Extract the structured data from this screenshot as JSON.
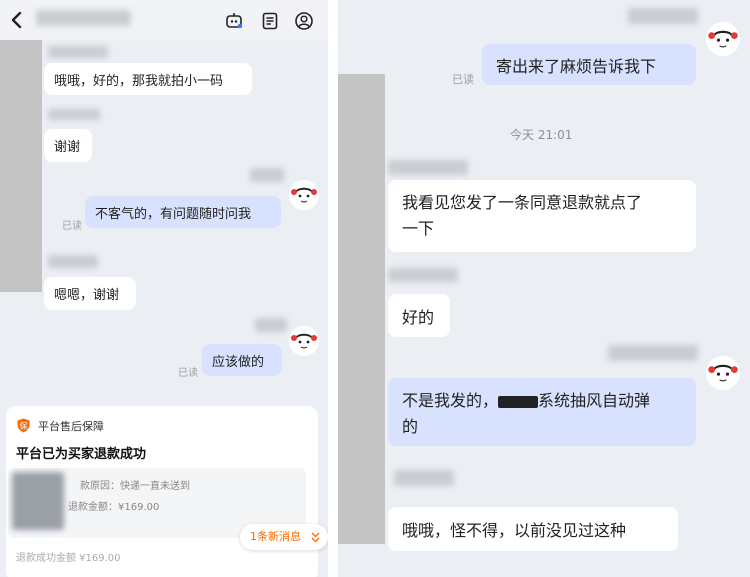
{
  "left": {
    "messages": {
      "m1": "哦哦，好的，那我就拍小一码",
      "m2": "谢谢",
      "m3": "不客气的，有问题随时问我",
      "m4": "嗯嗯，谢谢",
      "m5": "应该做的"
    },
    "read_label": "已读",
    "card": {
      "header": "平台售后保障",
      "badge": "保",
      "title": "平台已为买家退款成功",
      "reason": "款原因：快递一直未送到",
      "amount": "退款金额：¥169.00",
      "footer": "退款成功金额 ¥169.00"
    },
    "new_messages": "1条新消息",
    "colors": {
      "accent": "#ff6a00",
      "mine_bubble": "#d8e2ff"
    }
  },
  "right": {
    "messages": {
      "r1": "寄出来了麻烦告诉我下",
      "r2a": "我看见您发了一条同意退款就点了",
      "r2b": "一下",
      "r3": "好的",
      "r4a": "不是我发的，",
      "r4b": "系统抽风自动弹",
      "r4c": "的",
      "r5": "哦哦，怪不得，以前没见过这种"
    },
    "read_label": "已读",
    "timestamp": "今天 21:01"
  }
}
